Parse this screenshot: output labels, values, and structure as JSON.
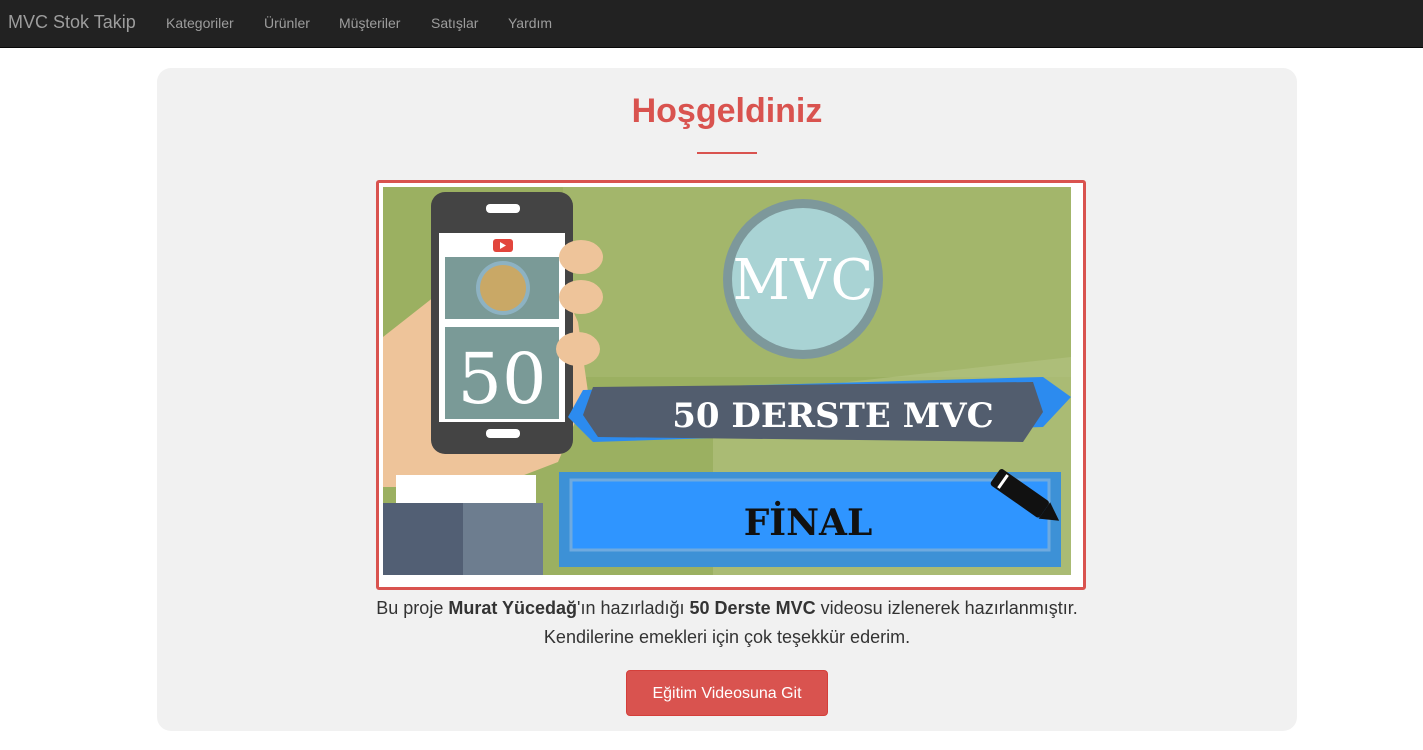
{
  "navbar": {
    "brand": "MVC Stok Takip",
    "links": [
      "Kategoriler",
      "Ürünler",
      "Müşteriler",
      "Satışlar",
      "Yardım"
    ]
  },
  "main": {
    "title": "Hoşgeldiniz",
    "thumbnail": {
      "badge": "MVC",
      "phone_number": "50",
      "banner_text": "50 DERSTE MVC",
      "final_label": "FİNAL"
    },
    "description": {
      "prefix": "Bu proje ",
      "author": "Murat Yücedağ",
      "middle": "'ın hazırladığı ",
      "course": "50 Derste MVC",
      "suffix": " videosu izlenerek hazırlanmıştır.",
      "line2": "Kendilerine emekleri için çok teşekkür ederim."
    },
    "button_label": "Eğitim Videosuna Git"
  },
  "colors": {
    "navbar": "#222222",
    "accent": "#d9534f",
    "panel": "#f1f1f1"
  }
}
